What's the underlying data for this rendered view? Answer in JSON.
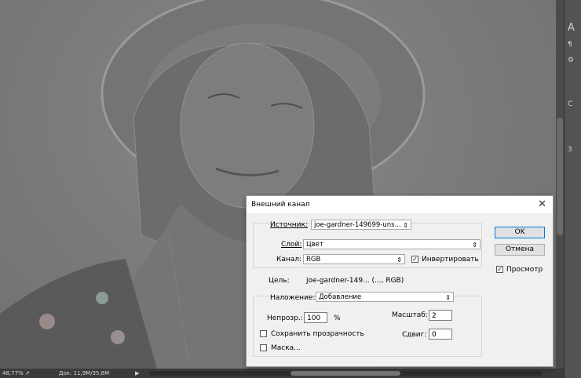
{
  "dialog": {
    "title": "Внешний канал",
    "close_glyph": "✕",
    "source": {
      "label": "Источник:",
      "value": "joe-gardner-149699-uns..."
    },
    "layer": {
      "label": "Слой:",
      "value": "Цвет"
    },
    "channel": {
      "label": "Канал:",
      "value": "RGB"
    },
    "invert": {
      "label": "Инвертировать",
      "checked": true
    },
    "target": {
      "label": "Цель:",
      "value": "joe-gardner-149... (..., RGB)"
    },
    "blending": {
      "label": "Наложение:",
      "value": "Добавление"
    },
    "opacity": {
      "label": "Непрозр.:",
      "value": "100",
      "unit": "%"
    },
    "scale": {
      "label": "Масштаб:",
      "value": "2"
    },
    "offset": {
      "label": "Сдвиг:",
      "value": "0"
    },
    "preserve_transparency": {
      "label": "Сохранить прозрачность",
      "checked": false
    },
    "mask": {
      "label": "Маска...",
      "checked": false
    },
    "ok_label": "OK",
    "cancel_label": "Отмена",
    "preview": {
      "label": "Просмотр",
      "checked": true
    }
  },
  "statusbar": {
    "zoom": "48,77%",
    "doc": "Док: 11,9M/35,8M",
    "arrow": "▶"
  },
  "right_panel": {
    "items": [
      "A",
      "¶",
      "⚙",
      "C",
      "3"
    ]
  },
  "icons": {
    "checkmark": "✓",
    "dropdown": "⇕"
  }
}
